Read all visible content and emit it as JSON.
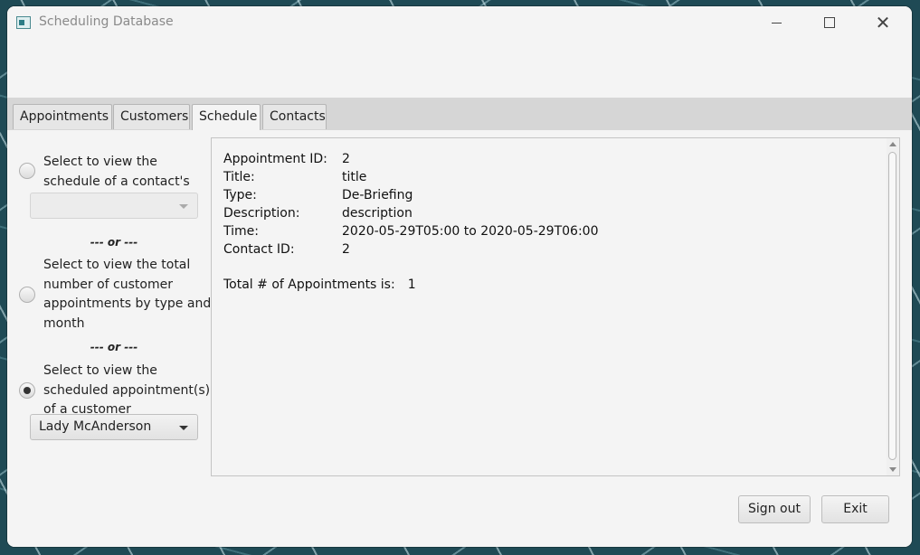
{
  "window": {
    "title": "Scheduling Database"
  },
  "tabs": [
    "Appointments",
    "Customers",
    "Schedule",
    "Contacts"
  ],
  "active_tab": "Schedule",
  "options": {
    "contact": {
      "label": "Select to view the schedule of a contact's apointment(s)",
      "checked": false,
      "dropdown_value": ""
    },
    "separator_1": "--- or ---",
    "type_month": {
      "label": "Select to view the total number of customer appointments by type and month",
      "checked": false
    },
    "separator_2": "--- or ---",
    "customer": {
      "label": "Select to view the scheduled appointment(s) of a customer",
      "checked": true,
      "dropdown_value": "Lady McAnderson"
    }
  },
  "result": {
    "fields": [
      {
        "key": "Appointment ID:",
        "value": "2"
      },
      {
        "key": "Title:",
        "value": "title"
      },
      {
        "key": "Type:",
        "value": "De-Briefing"
      },
      {
        "key": "Description:",
        "value": "description"
      },
      {
        "key": "Time:",
        "value": "2020-05-29T05:00 to 2020-05-29T06:00"
      },
      {
        "key": "Contact ID:",
        "value": "2"
      }
    ],
    "total_label": "Total # of Appointments is:",
    "total_value": "1"
  },
  "buttons": {
    "sign_out": "Sign out",
    "exit": "Exit"
  }
}
